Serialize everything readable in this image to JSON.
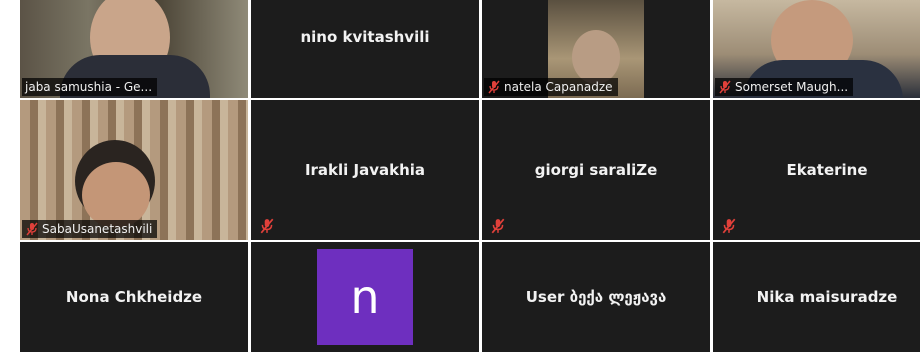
{
  "tiles": {
    "jaba": {
      "name": "jaba samushia - Ge..."
    },
    "nino": {
      "name": "nino kvitashvili"
    },
    "natela": {
      "name": "natela Capanadze"
    },
    "somerset": {
      "name": "Somerset Maugh..."
    },
    "saba": {
      "name": "SabaUsanetashvili"
    },
    "irakli": {
      "name": "Irakli Javakhia"
    },
    "giorgi": {
      "name": "giorgi saraliZe"
    },
    "ekaterine": {
      "name": "Ekaterine"
    },
    "nona": {
      "name": "Nona Chkheidze"
    },
    "n_avatar": {
      "initial": "n"
    },
    "user": {
      "name": "User ბექა ლეჟავა"
    },
    "nika": {
      "name": "Nika maisuradze"
    }
  },
  "colors": {
    "tile_bg": "#1c1c1c",
    "speaking_border": "#c8e64a",
    "avatar_bg": "#6e2fbf",
    "muted_icon": "#e0403a"
  },
  "icons": {
    "muted": "muted-microphone-icon"
  }
}
